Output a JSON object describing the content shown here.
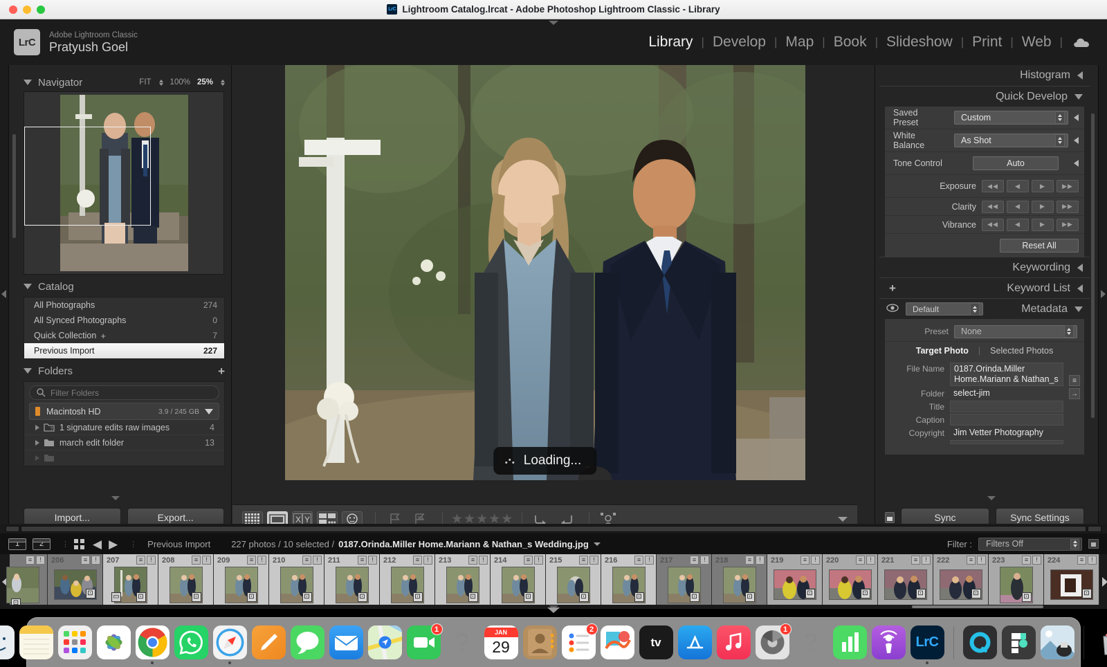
{
  "window": {
    "title": "Lightroom Catalog.lrcat - Adobe Photoshop Lightroom Classic - Library",
    "app_icon": "LrC"
  },
  "identity": {
    "logo_text": "LrC",
    "product": "Adobe Lightroom Classic",
    "user": "Pratyush Goel"
  },
  "modules": {
    "items": [
      {
        "label": "Library",
        "active": true
      },
      {
        "label": "Develop",
        "active": false
      },
      {
        "label": "Map",
        "active": false
      },
      {
        "label": "Book",
        "active": false
      },
      {
        "label": "Slideshow",
        "active": false
      },
      {
        "label": "Print",
        "active": false
      },
      {
        "label": "Web",
        "active": false
      }
    ],
    "cloud_icon": "cloud-icon"
  },
  "navigator": {
    "title": "Navigator",
    "fit": "FIT",
    "hundred": "100%",
    "zoom": "25%"
  },
  "catalog": {
    "title": "Catalog",
    "items": [
      {
        "label": "All Photographs",
        "count": "274",
        "selected": false
      },
      {
        "label": "All Synced Photographs",
        "count": "0",
        "selected": false
      },
      {
        "label": "Quick Collection",
        "count": "7",
        "selected": false,
        "plus": "+"
      },
      {
        "label": "Previous Import",
        "count": "227",
        "selected": true
      }
    ]
  },
  "folders": {
    "title": "Folders",
    "add_icon": "plus-icon",
    "filter_placeholder": "Filter Folders",
    "volume": {
      "name": "Macintosh HD",
      "size": "3.9 / 245 GB"
    },
    "items": [
      {
        "name": "1 signature edits raw images",
        "count": "4"
      },
      {
        "name": "march edit folder",
        "count": "13"
      }
    ]
  },
  "left_buttons": {
    "import": "Import...",
    "export": "Export..."
  },
  "photo": {
    "loading_text": "Loading..."
  },
  "toolbar": {
    "grid_view": "grid-view-icon",
    "loupe_view": "loupe-view-icon",
    "compare_view": "compare-view-icon",
    "survey_view": "survey-view-icon",
    "people_view": "people-view-icon",
    "flag": "flag-icon",
    "reject": "reject-flag-icon",
    "stars": "★★★★★",
    "rotate_right": "rotate-right-icon",
    "rotate_left": "rotate-left-icon",
    "painter": "painter-icon"
  },
  "right": {
    "histogram_title": "Histogram",
    "quick_develop_title": "Quick Develop",
    "keywording_title": "Keywording",
    "keyword_list_title": "Keyword List",
    "metadata_title": "Metadata",
    "quick_develop": {
      "saved_preset_label": "Saved Preset",
      "saved_preset_value": "Custom",
      "white_balance_label": "White Balance",
      "white_balance_value": "As Shot",
      "tone_control_label": "Tone Control",
      "auto_label": "Auto",
      "exposure_label": "Exposure",
      "clarity_label": "Clarity",
      "vibrance_label": "Vibrance",
      "reset_all": "Reset All",
      "nudge_dec2": "◀◀",
      "nudge_dec1": "◀",
      "nudge_inc1": "▶",
      "nudge_inc2": "▶▶"
    },
    "metadata": {
      "view_preset": "Default",
      "preset_label": "Preset",
      "preset_value": "None",
      "tab_target": "Target Photo",
      "tab_selected": "Selected Photos",
      "fields": [
        {
          "label": "File Name",
          "value": "0187.Orinda.Miller Home.Mariann & Nathan_s"
        },
        {
          "label": "Folder",
          "value": "select-jim"
        },
        {
          "label": "Title",
          "value": ""
        },
        {
          "label": "Caption",
          "value": ""
        },
        {
          "label": "Copyright",
          "value": "Jim Vetter Photography"
        }
      ]
    },
    "sync_label": "Sync",
    "sync_settings_label": "Sync Settings"
  },
  "filmstrip": {
    "screen1": "1",
    "screen2": "2",
    "source": "Previous Import",
    "count_text": "227 photos / 10 selected /",
    "file_name": "0187.Orinda.Miller Home.Mariann & Nathan_s Wedding.jpg",
    "filter_label": "Filter :",
    "filter_value": "Filters Off",
    "thumbs": [
      {
        "num": "206",
        "state": "dim",
        "ratio": "tall"
      },
      {
        "num": "207",
        "state": "light",
        "ratio": "tall"
      },
      {
        "num": "208",
        "state": "light",
        "ratio": "tall"
      },
      {
        "num": "209",
        "state": "light",
        "ratio": "tall"
      },
      {
        "num": "210",
        "state": "light",
        "ratio": "tall"
      },
      {
        "num": "211",
        "state": "light",
        "ratio": "tall"
      },
      {
        "num": "212",
        "state": "light",
        "ratio": "tall"
      },
      {
        "num": "213",
        "state": "light",
        "ratio": "tall"
      },
      {
        "num": "214",
        "state": "light",
        "ratio": "tall"
      },
      {
        "num": "215",
        "state": "light",
        "ratio": "tall"
      },
      {
        "num": "216",
        "state": "light",
        "ratio": "tall"
      },
      {
        "num": "217",
        "state": "dim",
        "ratio": "tall"
      },
      {
        "num": "218",
        "state": "dim",
        "ratio": "tall"
      },
      {
        "num": "219",
        "state": "normal",
        "ratio": "wide"
      },
      {
        "num": "220",
        "state": "normal",
        "ratio": "wide"
      },
      {
        "num": "221",
        "state": "normal",
        "ratio": "wide"
      },
      {
        "num": "222",
        "state": "normal",
        "ratio": "wide"
      },
      {
        "num": "223",
        "state": "normal",
        "ratio": "tall"
      },
      {
        "num": "224",
        "state": "normal",
        "ratio": "wide"
      }
    ]
  },
  "dock": {
    "items": [
      {
        "name": "finder",
        "badge": "",
        "running": true
      },
      {
        "name": "notes",
        "badge": "",
        "running": false
      },
      {
        "name": "launchpad",
        "badge": "",
        "running": false
      },
      {
        "name": "photos",
        "badge": "",
        "running": false
      },
      {
        "name": "chrome",
        "badge": "",
        "running": true
      },
      {
        "name": "whatsapp",
        "badge": "",
        "running": false
      },
      {
        "name": "safari",
        "badge": "",
        "running": true
      },
      {
        "name": "notes-alt",
        "badge": "",
        "running": false
      },
      {
        "name": "messages",
        "badge": "",
        "running": false
      },
      {
        "name": "mail",
        "badge": "",
        "running": false
      },
      {
        "name": "maps",
        "badge": "",
        "running": false
      },
      {
        "name": "facetime",
        "badge": "1",
        "running": false
      },
      {
        "name": "unknown-app",
        "badge": "",
        "running": false
      },
      {
        "name": "calendar",
        "badge": "",
        "running": false,
        "month": "JAN",
        "day": "29"
      },
      {
        "name": "contacts",
        "badge": "",
        "running": false
      },
      {
        "name": "reminders",
        "badge": "2",
        "running": false
      },
      {
        "name": "freeform",
        "badge": "",
        "running": false
      },
      {
        "name": "apple-tv",
        "badge": "",
        "running": false
      },
      {
        "name": "app-store",
        "badge": "",
        "running": false
      },
      {
        "name": "music",
        "badge": "",
        "running": false
      },
      {
        "name": "system-settings",
        "badge": "1",
        "running": false
      },
      {
        "name": "unknown-app-2",
        "badge": "",
        "running": false
      },
      {
        "name": "numbers",
        "badge": "",
        "running": false
      },
      {
        "name": "podcasts",
        "badge": "",
        "running": false
      },
      {
        "name": "lightroom-classic",
        "badge": "",
        "running": true
      },
      {
        "name": "quicktime",
        "badge": "",
        "running": false
      },
      {
        "name": "figma",
        "badge": "",
        "running": false
      },
      {
        "name": "preview-folder",
        "badge": "",
        "running": false
      },
      {
        "name": "trash",
        "badge": "",
        "running": false
      }
    ]
  },
  "colors": {
    "accent_blue": "#31a8ff",
    "panel_bg": "#252525",
    "panel_dark": "#1c1c1c",
    "quick_develop_bg": "#3a3a3a",
    "volume_orange": "#e08b2a",
    "badge_red": "#ff3b30"
  }
}
